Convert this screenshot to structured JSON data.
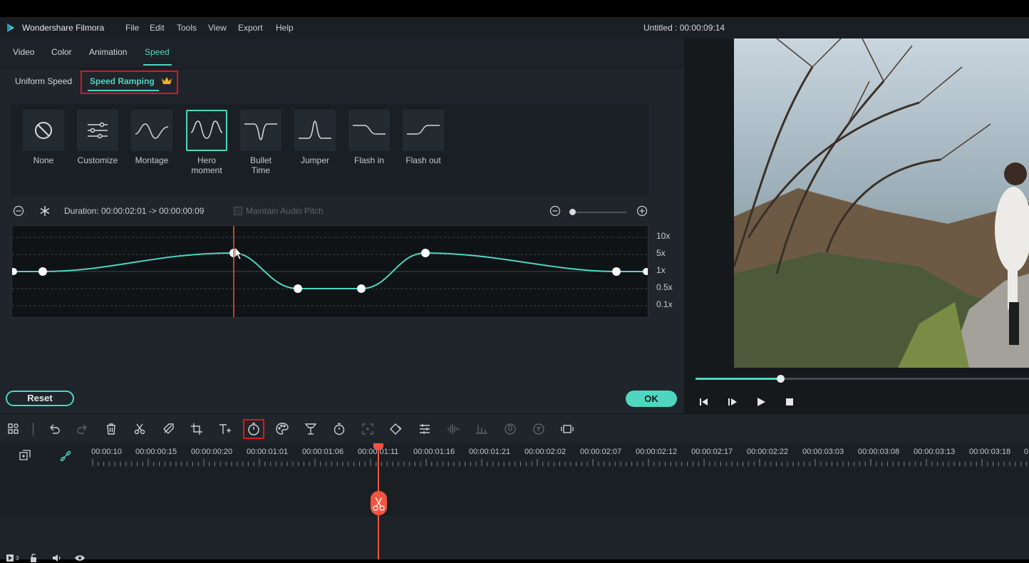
{
  "app": {
    "name": "Wondershare Filmora",
    "project_title": "Untitled : 00:00:09:14"
  },
  "menu": [
    "File",
    "Edit",
    "Tools",
    "View",
    "Export",
    "Help"
  ],
  "tabs": [
    "Video",
    "Color",
    "Animation",
    "Speed"
  ],
  "active_tab": "Speed",
  "subtabs": {
    "uniform": "Uniform Speed",
    "ramping": "Speed Ramping"
  },
  "presets": [
    {
      "label": "None",
      "icon": "no-entry-icon"
    },
    {
      "label": "Customize",
      "icon": "sliders-icon"
    },
    {
      "label": "Montage",
      "icon": "montage-curve-icon"
    },
    {
      "label": "Hero moment",
      "icon": "hero-moment-curve-icon",
      "selected": true
    },
    {
      "label": "Bullet Time",
      "icon": "bullet-time-curve-icon"
    },
    {
      "label": "Jumper",
      "icon": "jumper-curve-icon"
    },
    {
      "label": "Flash in",
      "icon": "flash-in-curve-icon"
    },
    {
      "label": "Flash out",
      "icon": "flash-out-curve-icon"
    }
  ],
  "duration": "Duration:  00:00:02:01 -> 00:00:00:09",
  "maintain_pitch": "Maintain Audio Pitch",
  "speed_levels": [
    "10x",
    "5x",
    "1x",
    "0.5x",
    "0.1x"
  ],
  "buttons": {
    "reset": "Reset",
    "ok": "OK"
  },
  "timeline": {
    "timecodes": [
      "00:00:10",
      "00:00:00:15",
      "00:00:00:20",
      "00:00:01:01",
      "00:00:01:06",
      "00:00:01:11",
      "00:00:01:16",
      "00:00:01:21",
      "00:00:02:02",
      "00:00:02:07",
      "00:00:02:12",
      "00:00:02:17",
      "00:00:02:22",
      "00:00:03:03",
      "00:00:03:08",
      "00:00:03:13",
      "00:00:03:18",
      "0"
    ],
    "track_number": "3"
  },
  "colors": {
    "accent": "#4ed6c0",
    "highlight": "#e0141e",
    "playhead": "#f2553f"
  }
}
